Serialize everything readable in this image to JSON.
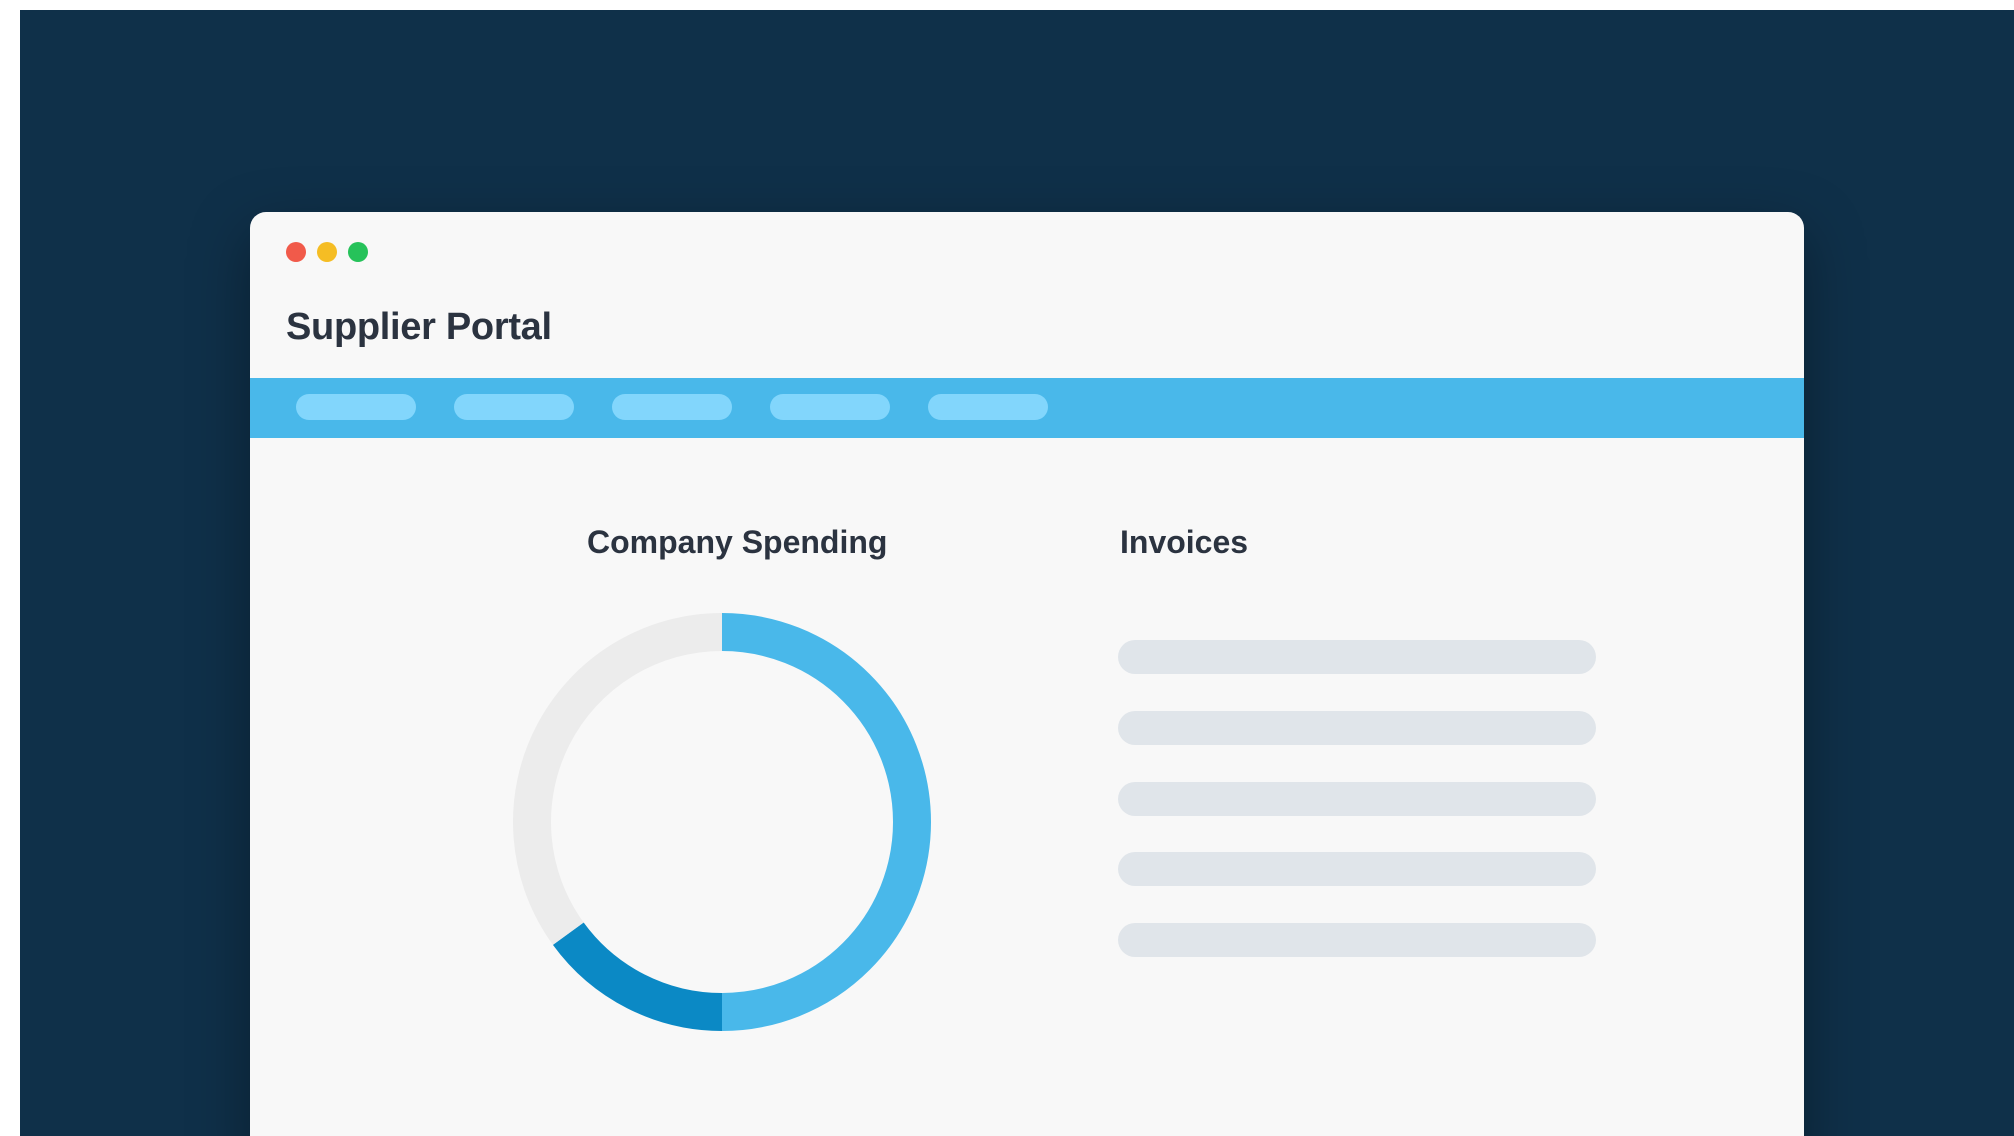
{
  "app": {
    "title": "Supplier Portal"
  },
  "window_controls": [
    {
      "name": "close",
      "color": "#f15a4a"
    },
    {
      "name": "minimize",
      "color": "#f5bd24"
    },
    {
      "name": "zoom",
      "color": "#26c25a"
    }
  ],
  "nav": {
    "item_count": 5,
    "bar_color": "#49b8ea",
    "pill_color": "#82d6fc"
  },
  "spending": {
    "title": "Company Spending",
    "chart_data": {
      "type": "pie",
      "style": "donut",
      "segments": [
        {
          "value": 50,
          "color": "#49b8ea"
        },
        {
          "value": 15,
          "color": "#0b89c5"
        },
        {
          "value": 35,
          "color": "#ececec"
        }
      ]
    }
  },
  "invoices": {
    "title": "Invoices",
    "line_count": 5,
    "line_color": "#e0e5ea"
  },
  "colors": {
    "background": "#0f3049",
    "window": "#f8f8f8",
    "text": "#2b3340"
  }
}
